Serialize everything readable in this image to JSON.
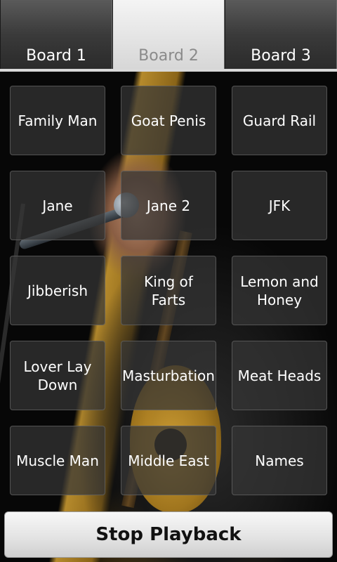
{
  "tabs": [
    {
      "label": "Board 1",
      "selected": false
    },
    {
      "label": "Board 2",
      "selected": true
    },
    {
      "label": "Board 3",
      "selected": false
    }
  ],
  "sounds": [
    "Family Man",
    "Goat Penis",
    "Guard Rail",
    "Jane",
    "Jane 2",
    "JFK",
    "Jibberish",
    "King of Farts",
    "Lemon and Honey",
    "Lover Lay Down",
    "Masturbation",
    "Meat Heads",
    "Muscle Man",
    "Middle East",
    "Names"
  ],
  "stop_button": {
    "label": "Stop Playback"
  },
  "colors": {
    "tab_selected_bg": "#e8e8e8",
    "tab_selected_text": "#8a8a8a",
    "tab_bg": "#3a3a3a",
    "button_bg": "#363636"
  }
}
